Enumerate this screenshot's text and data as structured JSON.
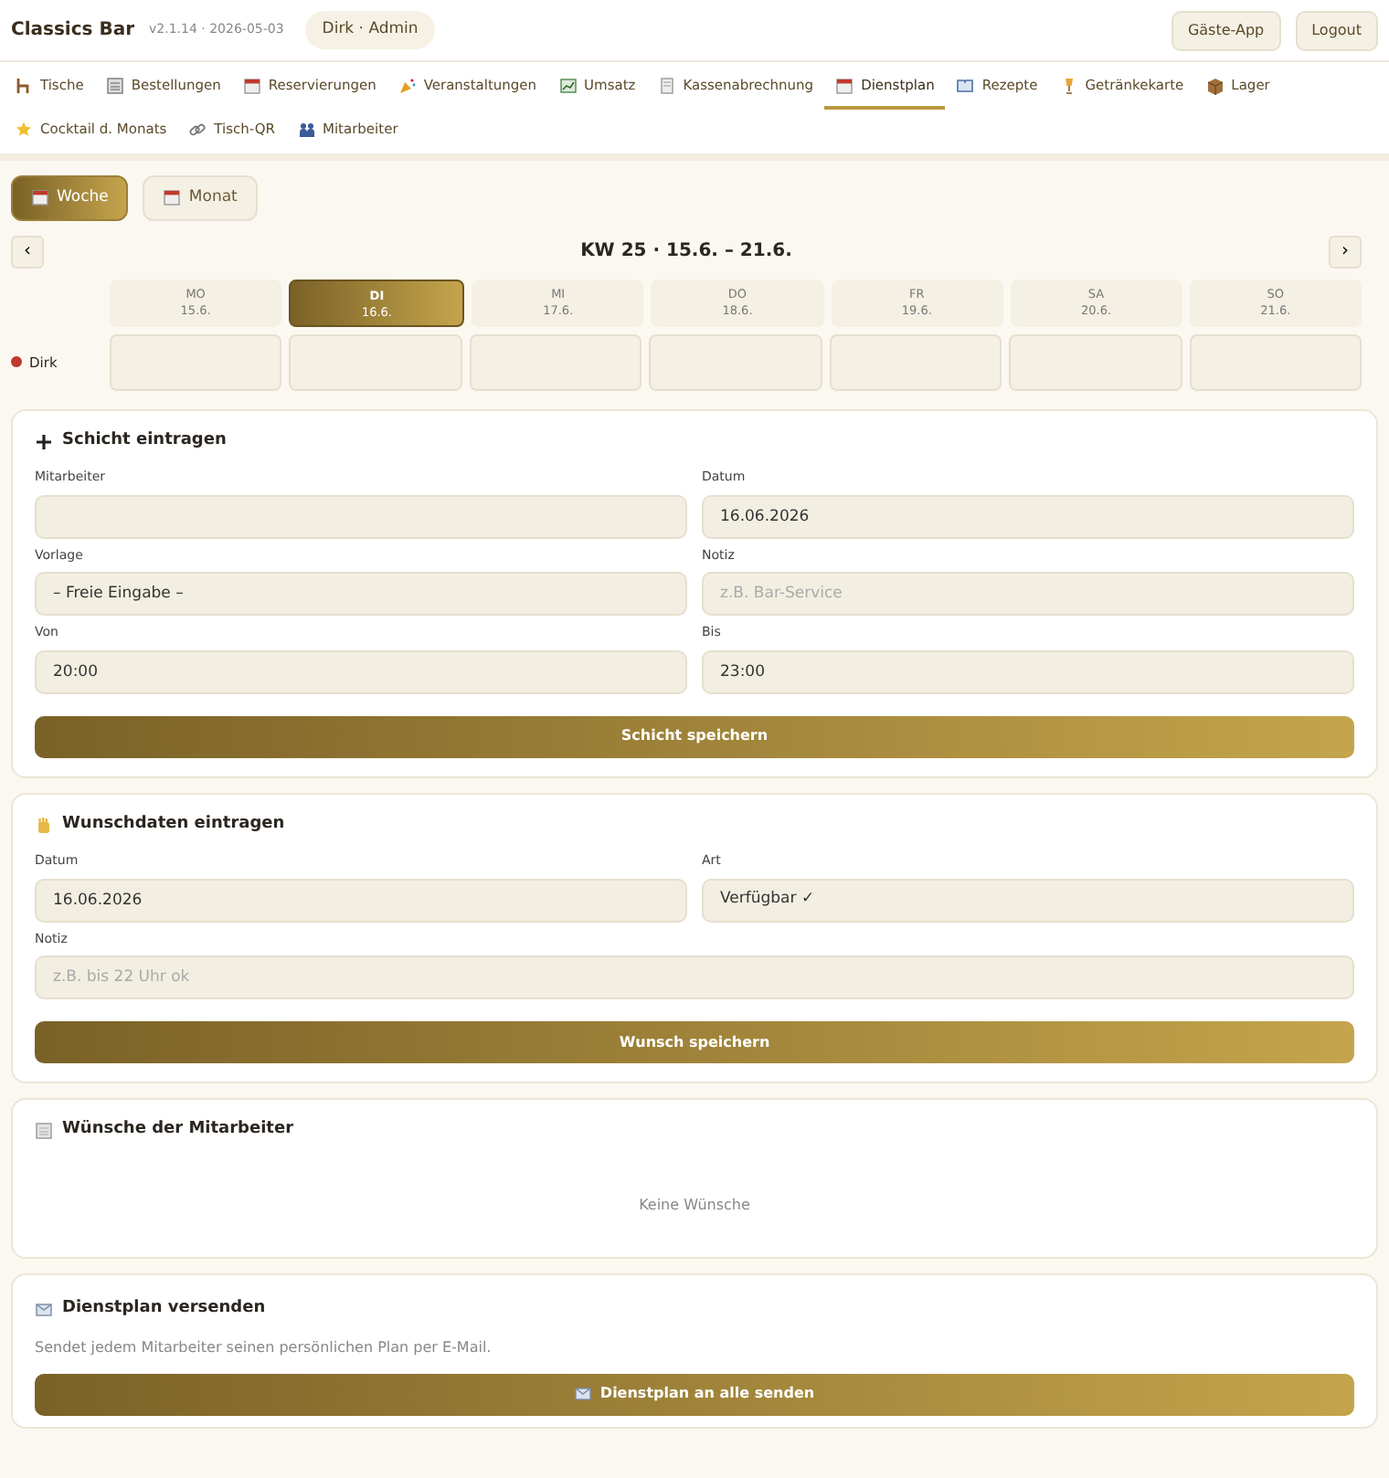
{
  "header": {
    "brand": "Classics Bar",
    "version": "v2.1.14 · 2026-05-03",
    "user": "Dirk · Admin",
    "buttons": [
      "Gäste-App",
      "Logout"
    ]
  },
  "nav": [
    {
      "label": "Tische",
      "selected": false
    },
    {
      "label": "Bestellungen",
      "selected": false
    },
    {
      "label": "Reservierungen",
      "selected": false
    },
    {
      "label": "Veranstaltungen",
      "selected": false
    },
    {
      "label": "Umsatz",
      "selected": false
    },
    {
      "label": "Kassenabrechnung",
      "selected": false
    },
    {
      "label": "Dienstplan",
      "selected": true
    },
    {
      "label": "Rezepte",
      "selected": false
    },
    {
      "label": "Getränkekarte",
      "selected": false
    },
    {
      "label": "Lager",
      "selected": false
    },
    {
      "label": "Cocktail d. Monats",
      "selected": false
    },
    {
      "label": "Tisch-QR",
      "selected": false
    },
    {
      "label": "Mitarbeiter",
      "selected": false
    }
  ],
  "view_toggle": [
    {
      "label": "Woche",
      "selected": true
    },
    {
      "label": "Monat",
      "selected": false
    }
  ],
  "week": {
    "prev": "‹",
    "title": "KW 25 · 15.6. – 21.6.",
    "next": "›",
    "days": [
      {
        "name": "MO",
        "date": "15.6.",
        "selected": false
      },
      {
        "name": "DI",
        "date": "16.6.",
        "selected": true
      },
      {
        "name": "MI",
        "date": "17.6.",
        "selected": false
      },
      {
        "name": "DO",
        "date": "18.6.",
        "selected": false
      },
      {
        "name": "FR",
        "date": "19.6.",
        "selected": false
      },
      {
        "name": "SA",
        "date": "20.6.",
        "selected": false
      },
      {
        "name": "SO",
        "date": "21.6.",
        "selected": false
      }
    ],
    "staff": [
      {
        "name": "Dirk",
        "color": "#c0392b"
      }
    ]
  },
  "shift_form": {
    "title": "Schicht eintragen",
    "rows": [
      [
        {
          "label": "Mitarbeiter",
          "kind": "select"
        },
        {
          "label": "Datum",
          "kind": "input",
          "value": "16.06.2026"
        }
      ],
      [
        {
          "label": "Vorlage",
          "kind": "select",
          "value": "– Freie Eingabe –"
        },
        {
          "label": "Notiz",
          "kind": "input",
          "placeholder": "z.B. Bar-Service"
        }
      ],
      [
        {
          "label": "Von",
          "kind": "input",
          "value": "20:00"
        },
        {
          "label": "Bis",
          "kind": "input",
          "value": "23:00"
        }
      ]
    ],
    "button": "Schicht speichern"
  },
  "wish_form": {
    "title": "Wunschdaten eintragen",
    "rows": [
      [
        {
          "label": "Datum",
          "kind": "input",
          "value": "16.06.2026"
        },
        {
          "label": "Art",
          "kind": "select",
          "value": "Verfügbar ✓"
        }
      ],
      [
        {
          "label": "Notiz",
          "kind": "input",
          "placeholder": "z.B. bis 22 Uhr ok"
        }
      ]
    ],
    "button": "Wunsch speichern"
  },
  "wishes": {
    "title": "Wünsche der Mitarbeiter",
    "empty": "Keine Wünsche"
  },
  "send": {
    "title": "Dienstplan versenden",
    "description": "Sendet jedem Mitarbeiter seinen persönlichen Plan per E-Mail.",
    "button": "Dienstplan an alle senden"
  }
}
